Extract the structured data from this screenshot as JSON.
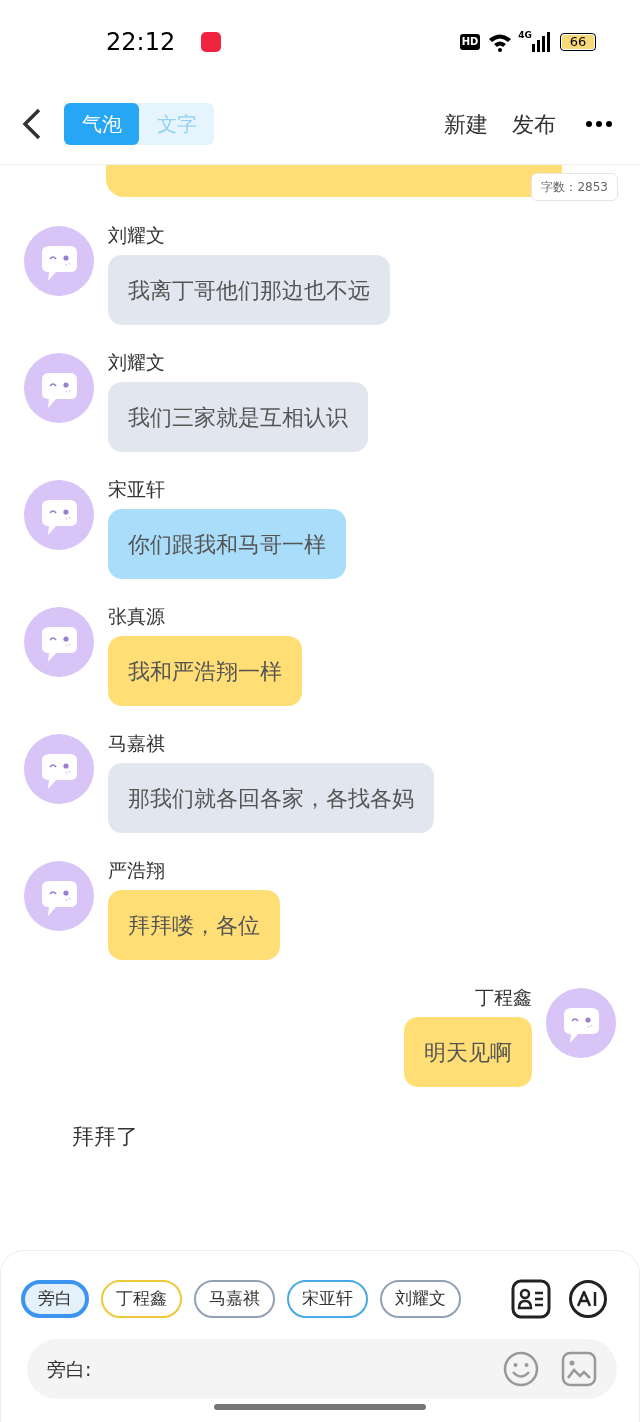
{
  "status_bar": {
    "time": "22:12",
    "hd": "HD",
    "network": "4G",
    "battery": "66"
  },
  "header": {
    "tabs": [
      {
        "label": "气泡",
        "selected": true
      },
      {
        "label": "文字",
        "selected": false
      }
    ],
    "actions": [
      "新建",
      "发布"
    ]
  },
  "word_count": "字数：2853",
  "top_bubble": {
    "color": "#ffde75"
  },
  "messages": [
    {
      "kind": "left",
      "name": "刘耀文",
      "text": "我离丁哥他们那边也不远",
      "color": "#e2e6ee"
    },
    {
      "kind": "left",
      "name": "刘耀文",
      "text": "我们三家就是互相认识",
      "color": "#e2e6ee"
    },
    {
      "kind": "left",
      "name": "宋亚轩",
      "text": "你们跟我和马哥一样",
      "color": "#a9ddf9"
    },
    {
      "kind": "left",
      "name": "张真源",
      "text": "我和严浩翔一样",
      "color": "#ffde75"
    },
    {
      "kind": "left",
      "name": "马嘉祺",
      "text": "那我们就各回各家，各找各妈",
      "color": "#e2e6ee"
    },
    {
      "kind": "left",
      "name": "严浩翔",
      "text": "拜拜喽，各位",
      "color": "#ffde75"
    },
    {
      "kind": "right",
      "name": "丁程鑫",
      "text": "明天见啊",
      "color": "#ffde75"
    },
    {
      "kind": "narration",
      "text": "拜拜了"
    }
  ],
  "roles": [
    {
      "label": "旁白",
      "selected": true,
      "color": "#3b95ee"
    },
    {
      "label": "丁程鑫",
      "selected": false,
      "color": "#edc93a"
    },
    {
      "label": "马嘉祺",
      "selected": false,
      "color": "#93a1b5"
    },
    {
      "label": "宋亚轩",
      "selected": false,
      "color": "#46a9e8"
    },
    {
      "label": "刘耀文",
      "selected": false,
      "color": "#93a1b5"
    }
  ],
  "input": {
    "placeholder": "旁白:"
  }
}
